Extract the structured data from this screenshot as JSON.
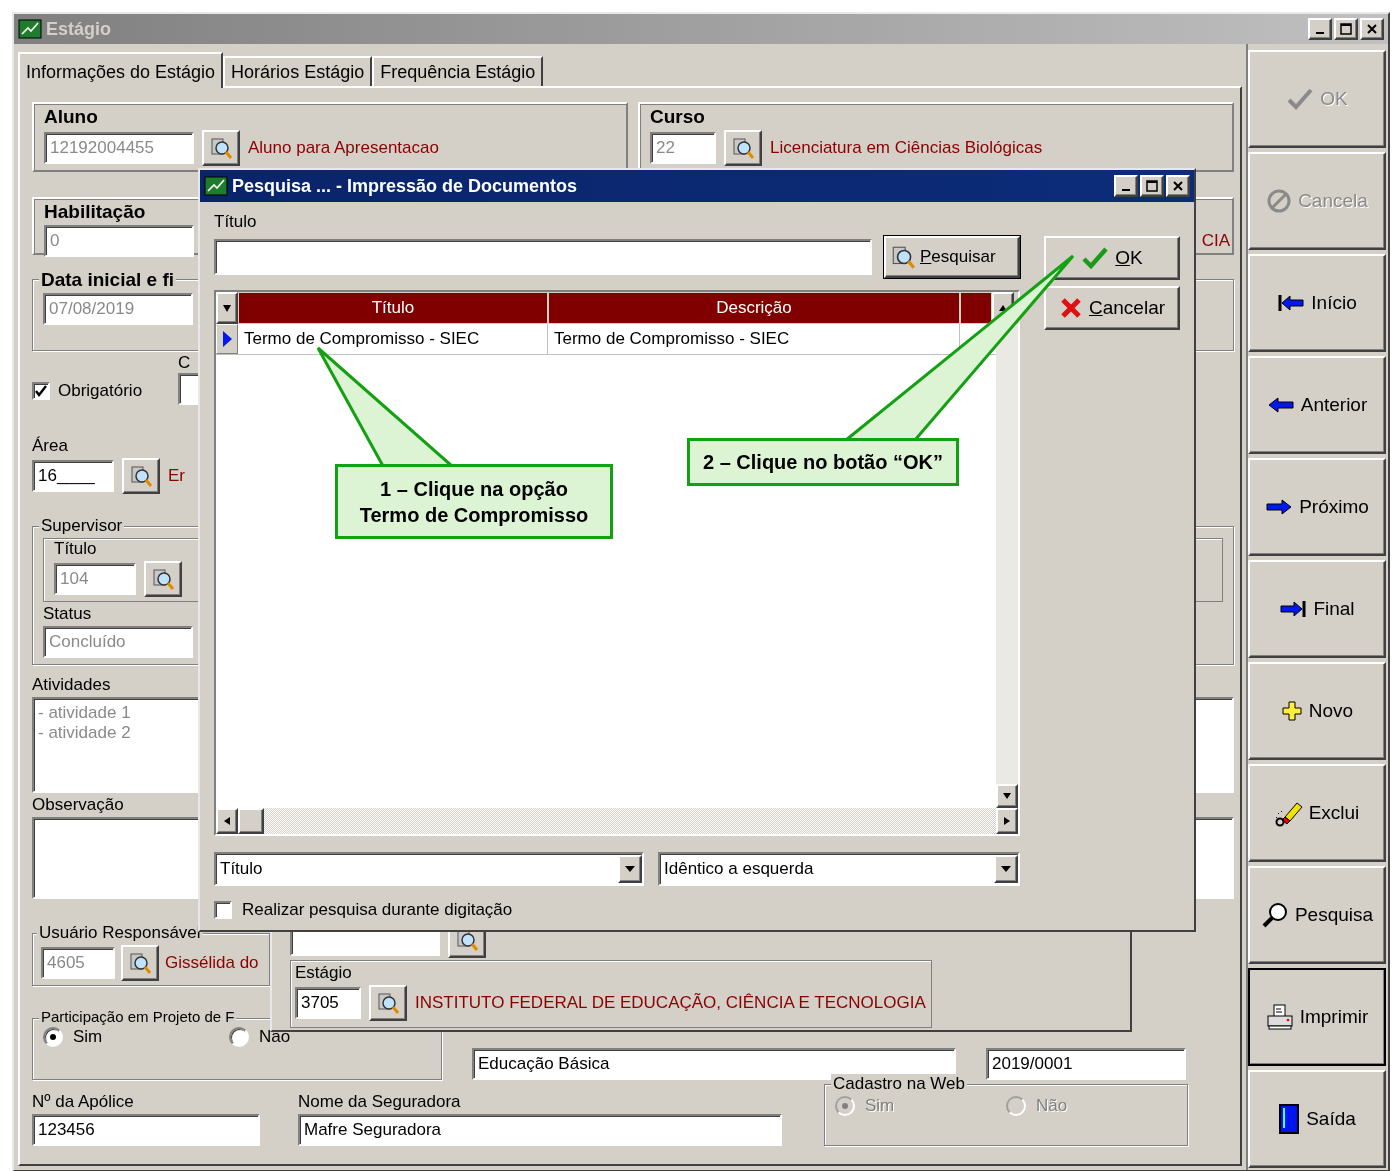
{
  "window": {
    "title": "Estágio"
  },
  "tabs": [
    {
      "label": "Informações do Estágio",
      "selected": true
    },
    {
      "label": "Horários Estágio",
      "selected": false
    },
    {
      "label": "Frequência Estágio",
      "selected": false
    }
  ],
  "aluno": {
    "label": "Aluno",
    "code": "12192004455",
    "name": "Aluno para Apresentacao"
  },
  "curso": {
    "label": "Curso",
    "code": "22",
    "name": "Licenciatura em Ciências Biológicas"
  },
  "habilitacao": {
    "label": "Habilitação",
    "code": "0",
    "name": "CIA"
  },
  "data_inicial": {
    "label": "Data inicial e fi",
    "value": "07/08/2019"
  },
  "obrigatorio": {
    "label": "Obrigatório",
    "checked": true
  },
  "c_label": "C",
  "area": {
    "label": "Área",
    "code": "16____",
    "name": "Er"
  },
  "supervisor": {
    "label": "Supervisor",
    "titulo_label": "Título",
    "titulo": "104",
    "status_label": "Status",
    "status": "Concluído"
  },
  "atividades": {
    "label": "Atividades",
    "lines": [
      "- atividade 1",
      "- atividade 2"
    ]
  },
  "observacao": {
    "label": "Observação"
  },
  "usuario": {
    "label": "Usuário Responsável",
    "code": "4605",
    "name": "Gissélida do"
  },
  "participacao": {
    "label": "Participação em Projeto de F",
    "options": [
      {
        "label": "Sim",
        "selected": true
      },
      {
        "label": "Não",
        "selected": false
      }
    ]
  },
  "educacao": {
    "value": "Educação Básica"
  },
  "codigo": {
    "value": "2019/0001"
  },
  "apolice": {
    "label": "Nº da Apólice",
    "value": "123456"
  },
  "seguradora": {
    "label": "Nome da Seguradora",
    "value": "Mafre Seguradora"
  },
  "cadastro_web": {
    "label": "Cadastro na Web",
    "disabled": true,
    "options": [
      {
        "label": "Sim",
        "selected": true
      },
      {
        "label": "Não",
        "selected": false
      }
    ]
  },
  "sub_window": {
    "estagio_label": "Estágio",
    "estagio_code": "3705",
    "estagio_name": "INSTITUTO FEDERAL DE EDUCAÇÃO, CIÊNCIA E TECNOLOGIA"
  },
  "toolbar": [
    {
      "label": "OK",
      "kind": "check",
      "disabled": true,
      "focused": false
    },
    {
      "label": "Cancela",
      "kind": "cancel",
      "disabled": true,
      "focused": false
    },
    {
      "label": "Início",
      "kind": "first",
      "disabled": false,
      "focused": false
    },
    {
      "label": "Anterior",
      "kind": "prev",
      "disabled": false,
      "focused": false
    },
    {
      "label": "Próximo",
      "kind": "next",
      "disabled": false,
      "focused": false
    },
    {
      "label": "Final",
      "kind": "last",
      "disabled": false,
      "focused": false
    },
    {
      "label": "Novo",
      "kind": "plus",
      "disabled": false,
      "focused": false
    },
    {
      "label": "Exclui",
      "kind": "eraser",
      "disabled": false,
      "focused": false
    },
    {
      "label": "Pesquisa",
      "kind": "search",
      "disabled": false,
      "focused": false
    },
    {
      "label": "Imprimir",
      "kind": "printer",
      "disabled": false,
      "focused": true
    },
    {
      "label": "Saída",
      "kind": "door",
      "disabled": false,
      "focused": false
    }
  ],
  "dialog": {
    "title": "Pesquisa ... - Impressão de Documentos",
    "field_label": "Título",
    "search_button": "Pesquisar",
    "ok_button": "OK",
    "cancel_button": "Cancelar",
    "table": {
      "columns": [
        "Título",
        "Descrição"
      ],
      "rows": [
        {
          "cells": [
            "Termo de Compromisso - SIEC",
            "Termo de Compromisso - SIEC"
          ],
          "selected": true
        }
      ]
    },
    "field_combo": "Título",
    "match_combo": "Idêntico a esquerda",
    "live_search": {
      "label": "Realizar pesquisa durante digitação",
      "checked": false
    }
  },
  "callouts": [
    {
      "lines": [
        "1 – Clique na opção",
        "Termo de Compromisso"
      ]
    },
    {
      "lines": [
        "2 – Clique no botão “OK”"
      ]
    }
  ]
}
